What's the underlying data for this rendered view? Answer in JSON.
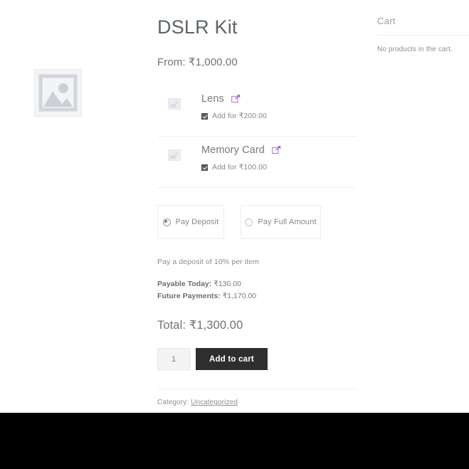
{
  "product": {
    "title": "DSLR Kit",
    "price_from_label": "From: ₹1,000.00",
    "addons": [
      {
        "name": "Lens",
        "link_icon": "external-link-icon",
        "checkbox_label": "Add for  ₹200.00",
        "checked": true,
        "thumb_icon": "image-placeholder-icon"
      },
      {
        "name": "Memory Card",
        "link_icon": "external-link-icon",
        "checkbox_label": "Add for  ₹100.00",
        "checked": true,
        "thumb_icon": "image-placeholder-icon"
      }
    ],
    "deposit_options": [
      {
        "label": "Pay Deposit",
        "selected": true
      },
      {
        "label": "Pay Full Amount",
        "selected": false
      }
    ],
    "deposit_note": "Pay a deposit of 10% per item",
    "payable_today_label": "Payable Today:",
    "payable_today_value": " ₹130.00",
    "future_payments_label": "Future Payments:",
    "future_payments_value": " ₹1,170.00",
    "total_label": "Total: ₹1,300.00",
    "quantity": "1",
    "add_to_cart_label": "Add to cart",
    "category_prefix": "Category: ",
    "category_value": "Uncategorized",
    "gallery_icon": "image-placeholder-icon"
  },
  "sidebar": {
    "cart_heading": "Cart",
    "cart_empty_text": "No products in the cart."
  },
  "colors": {
    "accent_link": "#a855c9",
    "button_bg": "#2e2e2e",
    "text_muted": "#8d9093"
  }
}
